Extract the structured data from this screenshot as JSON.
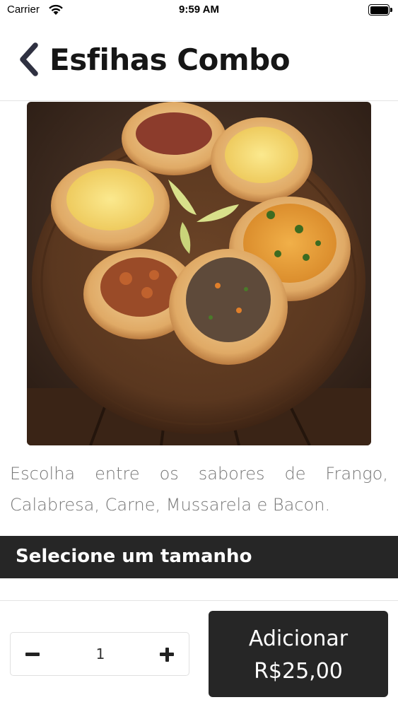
{
  "status_bar": {
    "carrier": "Carrier",
    "time": "9:59 AM",
    "icons": [
      "wifi-icon",
      "battery-icon"
    ]
  },
  "header": {
    "title": "Esfihas Combo",
    "back_icon": "chevron-left-icon"
  },
  "product": {
    "image_subject": "wooden-board-of-esfihas",
    "description": "Escolha entre os sabores de Frango, Calabresa, Carne, Mussarela e Bacon."
  },
  "size_section": {
    "title": "Selecione um tamanho"
  },
  "footer": {
    "quantity": "1",
    "minus_icon": "minus-icon",
    "plus_icon": "plus-icon",
    "add_label": "Adicionar",
    "add_price": "R$25,00"
  },
  "colors": {
    "dark": "#262626",
    "text": "#161616",
    "muted": "#777777",
    "divider": "#e3e3e3"
  }
}
